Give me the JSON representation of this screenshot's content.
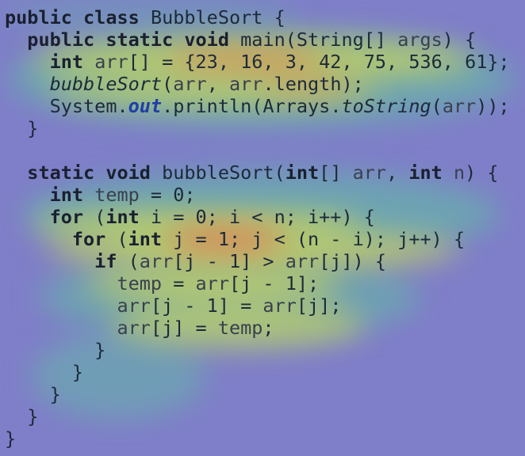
{
  "code": {
    "language": "java",
    "lines": [
      [
        {
          "t": "public class ",
          "k": "kw"
        },
        {
          "t": "BubbleSort {",
          "k": ""
        }
      ],
      [
        {
          "t": "  public static void ",
          "k": "kw"
        },
        {
          "t": "main(String[] ",
          "k": ""
        },
        {
          "t": "args",
          "k": "var"
        },
        {
          "t": ") {",
          "k": ""
        }
      ],
      [
        {
          "t": "    int ",
          "k": "kw"
        },
        {
          "t": "arr",
          "k": "var"
        },
        {
          "t": "[] = {23, 16, 3, 42, 75, 536, 61};",
          "k": ""
        }
      ],
      [
        {
          "t": "    ",
          "k": ""
        },
        {
          "t": "bubbleSort",
          "k": "fn-it"
        },
        {
          "t": "(",
          "k": ""
        },
        {
          "t": "arr",
          "k": "var"
        },
        {
          "t": ", ",
          "k": ""
        },
        {
          "t": "arr",
          "k": "var"
        },
        {
          "t": ".length);",
          "k": ""
        }
      ],
      [
        {
          "t": "    System.",
          "k": ""
        },
        {
          "t": "out",
          "k": "out"
        },
        {
          "t": ".println(Arrays.",
          "k": ""
        },
        {
          "t": "toString",
          "k": "fn-it"
        },
        {
          "t": "(",
          "k": ""
        },
        {
          "t": "arr",
          "k": "var"
        },
        {
          "t": "));",
          "k": ""
        }
      ],
      [
        {
          "t": "  }",
          "k": ""
        }
      ],
      [
        {
          "t": "",
          "k": ""
        }
      ],
      [
        {
          "t": "  static void ",
          "k": "kw"
        },
        {
          "t": "bubbleSort(",
          "k": ""
        },
        {
          "t": "int",
          "k": "kw"
        },
        {
          "t": "[] ",
          "k": ""
        },
        {
          "t": "arr",
          "k": "var"
        },
        {
          "t": ", ",
          "k": ""
        },
        {
          "t": "int ",
          "k": "kw"
        },
        {
          "t": "n",
          "k": "var"
        },
        {
          "t": ") {",
          "k": ""
        }
      ],
      [
        {
          "t": "    int ",
          "k": "kw"
        },
        {
          "t": "temp",
          "k": "var"
        },
        {
          "t": " = 0;",
          "k": ""
        }
      ],
      [
        {
          "t": "    for ",
          "k": "kw"
        },
        {
          "t": "(",
          "k": ""
        },
        {
          "t": "int ",
          "k": "kw"
        },
        {
          "t": "i = 0; i < n; i++) {",
          "k": ""
        }
      ],
      [
        {
          "t": "      for ",
          "k": "kw"
        },
        {
          "t": "(",
          "k": ""
        },
        {
          "t": "int ",
          "k": "kw"
        },
        {
          "t": "j = 1; j < (n - i); j++) {",
          "k": ""
        }
      ],
      [
        {
          "t": "        if ",
          "k": "kw"
        },
        {
          "t": "(",
          "k": ""
        },
        {
          "t": "arr",
          "k": "var"
        },
        {
          "t": "[j - 1] > ",
          "k": ""
        },
        {
          "t": "arr",
          "k": "var"
        },
        {
          "t": "[j]) {",
          "k": ""
        }
      ],
      [
        {
          "t": "          ",
          "k": ""
        },
        {
          "t": "temp",
          "k": "var"
        },
        {
          "t": " = ",
          "k": ""
        },
        {
          "t": "arr",
          "k": "var"
        },
        {
          "t": "[j - 1];",
          "k": ""
        }
      ],
      [
        {
          "t": "          ",
          "k": ""
        },
        {
          "t": "arr",
          "k": "var"
        },
        {
          "t": "[j - 1] = ",
          "k": ""
        },
        {
          "t": "arr",
          "k": "var"
        },
        {
          "t": "[j];",
          "k": ""
        }
      ],
      [
        {
          "t": "          ",
          "k": ""
        },
        {
          "t": "arr",
          "k": "var"
        },
        {
          "t": "[j] = ",
          "k": ""
        },
        {
          "t": "temp",
          "k": "var"
        },
        {
          "t": ";",
          "k": ""
        }
      ],
      [
        {
          "t": "        }",
          "k": ""
        }
      ],
      [
        {
          "t": "      }",
          "k": ""
        }
      ],
      [
        {
          "t": "    }",
          "k": ""
        }
      ],
      [
        {
          "t": "  }",
          "k": ""
        }
      ],
      [
        {
          "t": "}",
          "k": ""
        }
      ]
    ]
  },
  "colors": {
    "background": "#7f7ec9",
    "heat_low": "#5fc3c0",
    "heat_mid": "#c8d860",
    "heat_high": "#e07050",
    "keyword": "#1a2030",
    "field_out": "#1f3fa8"
  }
}
